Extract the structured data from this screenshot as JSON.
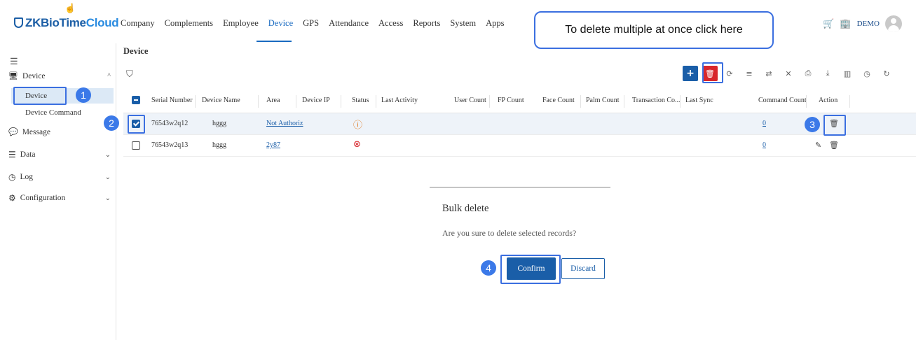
{
  "app": {
    "logo_main": "ZKBioTime",
    "logo_accent": "Cloud",
    "user_name": "DEMO"
  },
  "nav": {
    "items": [
      "Company",
      "Complements",
      "Employee",
      "Device",
      "GPS",
      "Attendance",
      "Access",
      "Reports",
      "System",
      "Apps"
    ],
    "active": "Device"
  },
  "sidebar": {
    "device_label": "Device",
    "device_sub": "Device",
    "device_command": "Device Command",
    "message": "Message",
    "data": "Data",
    "log": "Log",
    "configuration": "Configuration"
  },
  "page": {
    "title": "Device"
  },
  "table": {
    "headers": [
      "Serial Number",
      "Device Name",
      "Area",
      "Device IP",
      "Status",
      "Last Activity",
      "User Count",
      "FP Count",
      "Face Count",
      "Palm Count",
      "Transaction Co...",
      "Last Sync",
      "Command Count",
      "Action"
    ],
    "rows": [
      {
        "serial": "76543w2q12",
        "name": "hggg",
        "area": "Not Authoriz",
        "command_count": "0",
        "status": "warning",
        "checked": true
      },
      {
        "serial": "76543w2q13",
        "name": "hggg",
        "area": "2y87",
        "command_count": "0",
        "status": "error",
        "checked": false
      }
    ]
  },
  "dialog": {
    "title": "Bulk delete",
    "message": "Are you sure to delete selected records?",
    "confirm": "Confirm",
    "discard": "Discard"
  },
  "annotations": {
    "callout": "To delete multiple at once click here",
    "steps": [
      "1",
      "2",
      "3",
      "4"
    ]
  },
  "colors": {
    "primary": "#1a5ea8",
    "danger": "#d8262c",
    "annotation": "#3b79e8"
  }
}
